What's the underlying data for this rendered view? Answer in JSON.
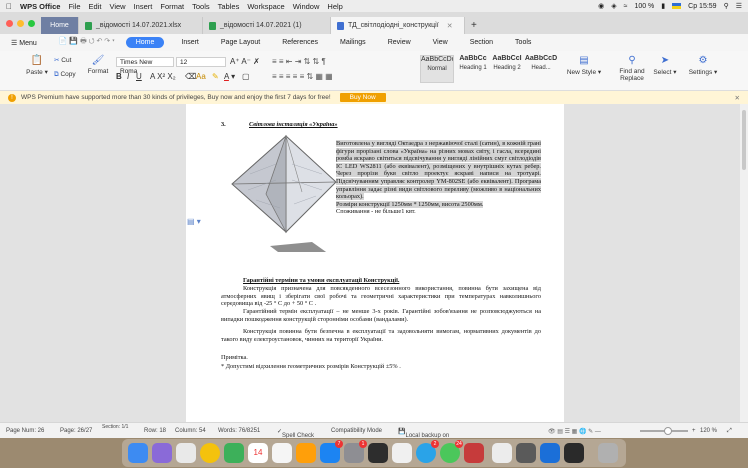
{
  "menubar": {
    "apple": "",
    "app_name": "WPS Office",
    "items": [
      "File",
      "Edit",
      "View",
      "Insert",
      "Format",
      "Tools",
      "Tables",
      "Workspace",
      "Window",
      "Help"
    ],
    "battery": "100 %",
    "datetime": "Ср 15:59"
  },
  "tabs": {
    "home_label": "Home",
    "documents": [
      {
        "label": "_відомості 14.07.2021.xlsx",
        "color": "#2e9f4f"
      },
      {
        "label": "_відомості 14.07.2021 (1)",
        "color": "#2e9f4f"
      },
      {
        "label": "ТД_світлодіодні_конструкції",
        "color": "#3f6fd1"
      }
    ],
    "add": "+"
  },
  "ribbon": {
    "menu": "Menu",
    "tabs": [
      "Home",
      "Insert",
      "Page Layout",
      "References",
      "Mailings",
      "Review",
      "View",
      "Section",
      "Tools"
    ],
    "active_tab": "Home"
  },
  "toolbar": {
    "paste": "Paste",
    "cut": "Cut",
    "copy": "Copy",
    "format": "Format",
    "font_name": "Times New Roma",
    "font_size": "12",
    "styles": [
      {
        "sample": "AaBbCcDd",
        "name": "Normal"
      },
      {
        "sample": "AaBbCc",
        "name": "Heading 1"
      },
      {
        "sample": "AaBbCcI",
        "name": "Heading 2"
      },
      {
        "sample": "AaBbCcD",
        "name": "Head..."
      }
    ],
    "new_style": "New Style",
    "find_replace": "Find and Replace",
    "select": "Select",
    "settings": "Settings"
  },
  "banner": {
    "text": "WPS Premium have supported more than 30 kinds of privileges, Buy now and enjoy the first 7 days for free!",
    "button": "Buy Now"
  },
  "document": {
    "section_number": "3.",
    "section_title": "Світлова інсталяція «Україна»",
    "description": "Виготовлена у вигляді Октаедра з нержавіючої сталі (сатин), в кожній грані фігури прорізані слова «Україна» на різних мовах світу, і гасла, всередині ромба яскраво світиться підсвічування у вигляді лінійних смуг світлодіодів IC LED WS2811 (або еквівалент), розміщених у внутрішніх кутах ребер. Через прорізи букв світло проектує яскраві написи на тротуарі. Підсвічуванням управляє контролер YM-802SE (або еквівалент). Програма управління задає різні види світлового переливу (можливо в національних кольорах).",
    "dimensions": "Розміри конструкції 1250мм * 1250мм, висота 2500мм.",
    "power": "Споживання - не більше1 квт.",
    "warranty_title": "Гарантійні терміни та умови експлуатації Конструкції.",
    "warranty_p1": "Конструкція призначена для повсякденного всесезонного використання, повинна бути захищена від атмосферних явищ і зберігати свої робочі та геометричні характеристики при температурах навколишнього середовища від -25 ° С до + 50 ° С .",
    "warranty_p2": "Гарантійний термін експлуатації – не менше 3-х років. Гарантійні зобов'язання не розповсюджуються на випадки пошкодження конструкцій сторонніми особами (вандалами).",
    "warranty_p3": "Конструкція повинна бути безпечна в експлуатації та задовольняти вимогам, нормативних документів до такого виду електроустановок, чинних на території України.",
    "note_title": "Примітка.",
    "note_text": "* Допустимі відхилення геометричних розмірів Конструкцій ±5% ."
  },
  "statusbar": {
    "page_num": "Page Num: 26",
    "page": "Page: 26/27",
    "section": "Section: 1/1",
    "row": "Row: 18",
    "column": "Column: 54",
    "words": "Words: 76/8251",
    "spell": "Spell Check",
    "compat": "Compatibility Mode",
    "backup": "Local backup on",
    "zoom": "120 %"
  },
  "dock": {
    "badges": [
      "7",
      "1",
      "2",
      "24"
    ],
    "calendar_day": "14"
  }
}
